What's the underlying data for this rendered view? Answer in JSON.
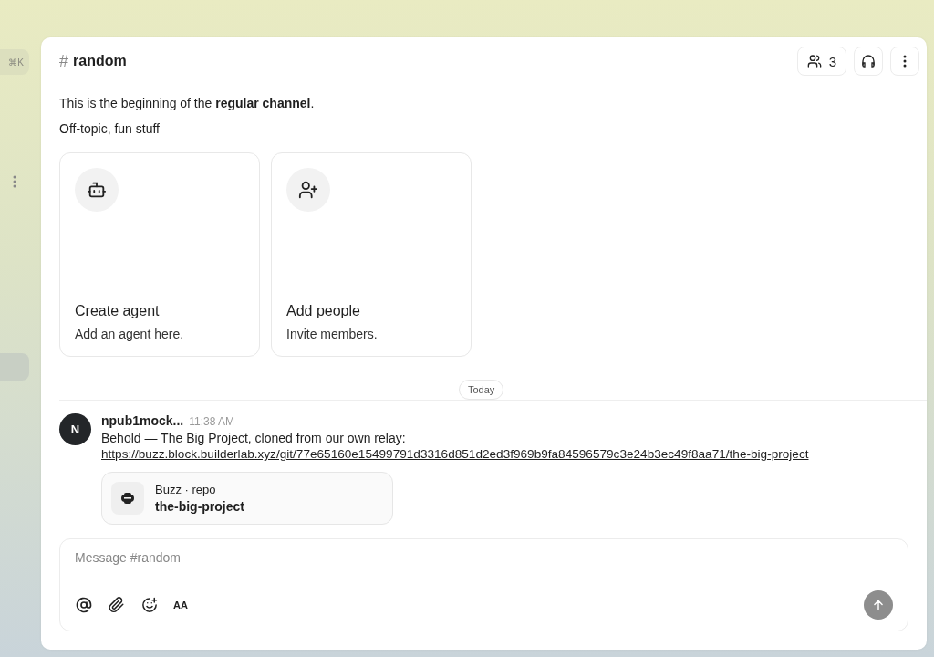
{
  "sidebar": {
    "shortcut": "⌘K"
  },
  "header": {
    "hash": "#",
    "channel": "random",
    "member_count": "3"
  },
  "intro": {
    "text": "This is the beginning of the **regular channel**.",
    "topic": "Off-topic, fun stuff"
  },
  "cards": [
    {
      "kind": "agent",
      "title": "Create agent",
      "subtitle": "Add an agent here."
    },
    {
      "kind": "people",
      "title": "Add people",
      "subtitle": "Invite members."
    }
  ],
  "divider": {
    "label": "Today"
  },
  "messages": [
    {
      "avatar": "N",
      "author": "npub1mock...",
      "time": "11:38 AM",
      "text": "Behold — The Big Project, cloned from our own relay:",
      "link": "https://buzz.block.builderlab.xyz/git/77e65160e15499791d3316d851d2ed3f969b9fa84596579c3e24b3ec49f8aa71/the-big-project",
      "attachment": {
        "source": "Buzz · repo",
        "name": "the-big-project"
      }
    }
  ],
  "composer": {
    "placeholder": "Message #random",
    "format_label": "AA"
  }
}
